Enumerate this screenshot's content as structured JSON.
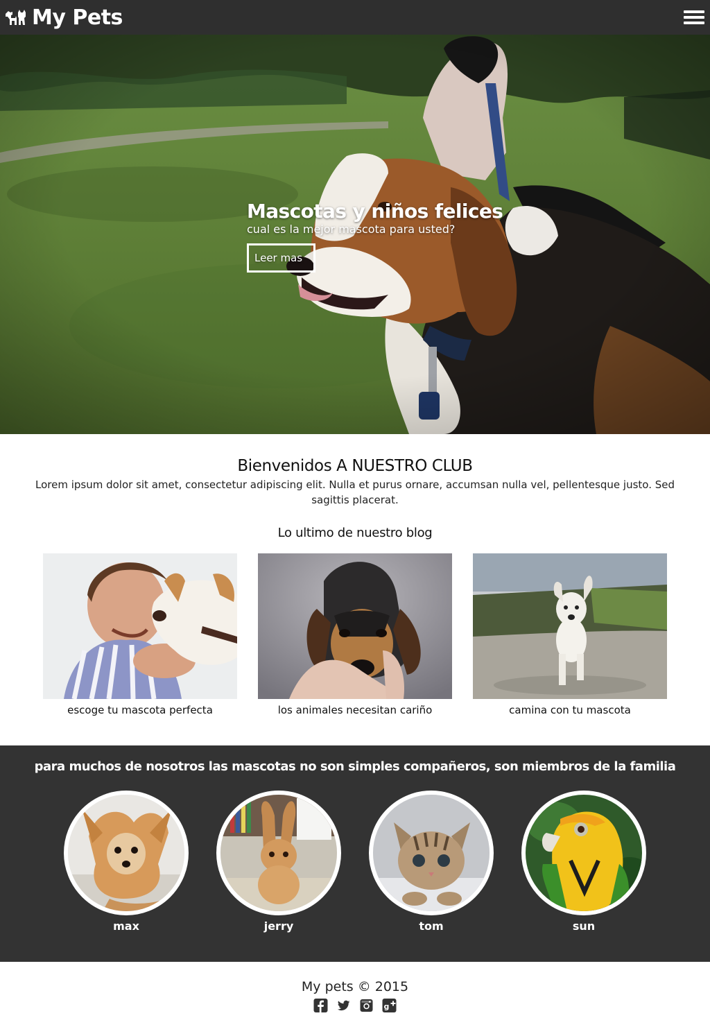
{
  "header": {
    "brand": "My Pets",
    "logo_icon": "dog-and-cat-icon",
    "menu_icon": "hamburger-menu-icon"
  },
  "hero": {
    "title": "Mascotas y niños felices",
    "subtitle": "cual es la mejor mascota para usted?",
    "button_label": "Leer mas"
  },
  "welcome": {
    "title": "Bienvenidos A NUESTRO CLUB",
    "text": "Lorem ipsum dolor sit amet, consectetur adipiscing elit. Nulla et purus ornare, accumsan nulla vel, pellentesque justo. Sed sagittis placerat."
  },
  "blog": {
    "title": "Lo ultimo de nuestro blog",
    "posts": [
      {
        "caption": "escoge tu mascota perfecta"
      },
      {
        "caption": "los animales necesitan cariño"
      },
      {
        "caption": "camina con tu mascota"
      }
    ]
  },
  "family": {
    "title": "para muchos de nosotros las mascotas no son simples compañeros, son miembros de la familia",
    "pets": [
      {
        "name": "max"
      },
      {
        "name": "jerry"
      },
      {
        "name": "tom"
      },
      {
        "name": "sun"
      }
    ]
  },
  "footer": {
    "copyright": "My pets © 2015",
    "socials": [
      "facebook-icon",
      "twitter-icon",
      "instagram-icon",
      "google-plus-icon"
    ]
  },
  "colors": {
    "header_bg": "#2f2f2f",
    "family_bg": "#333333",
    "text": "#222222"
  }
}
